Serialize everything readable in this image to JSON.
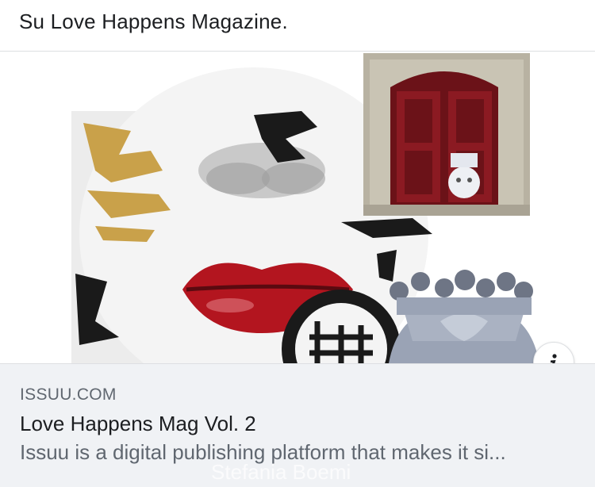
{
  "post": {
    "text": "Su Love Happens Magazine."
  },
  "link_card": {
    "domain": "ISSUU.COM",
    "title": "Love Happens Mag Vol. 2",
    "description": "Issuu is a digital publishing platform that makes it si...",
    "watermark": "Stefania Boemi",
    "info_icon": "info-icon"
  },
  "colors": {
    "lips": "#b3151f",
    "door": "#8b1a22",
    "gold_calligraphy": "#c9a14a",
    "crown_ceramic": "#9aa3b5",
    "caption_bg": "#f0f2f5"
  }
}
